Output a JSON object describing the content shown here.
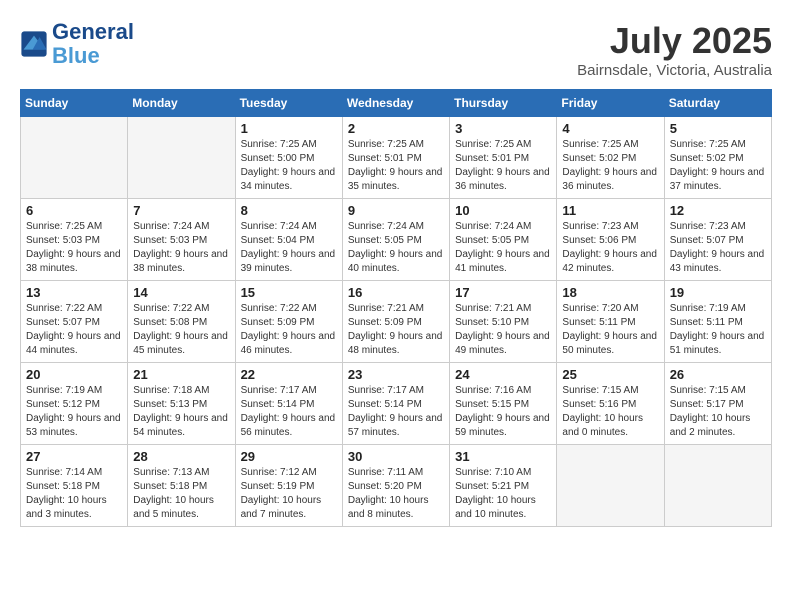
{
  "logo": {
    "line1": "General",
    "line2": "Blue"
  },
  "title": "July 2025",
  "location": "Bairnsdale, Victoria, Australia",
  "days_of_week": [
    "Sunday",
    "Monday",
    "Tuesday",
    "Wednesday",
    "Thursday",
    "Friday",
    "Saturday"
  ],
  "weeks": [
    [
      {
        "day": "",
        "empty": true
      },
      {
        "day": "",
        "empty": true
      },
      {
        "day": "1",
        "sunrise": "7:25 AM",
        "sunset": "5:00 PM",
        "daylight": "9 hours and 34 minutes."
      },
      {
        "day": "2",
        "sunrise": "7:25 AM",
        "sunset": "5:01 PM",
        "daylight": "9 hours and 35 minutes."
      },
      {
        "day": "3",
        "sunrise": "7:25 AM",
        "sunset": "5:01 PM",
        "daylight": "9 hours and 36 minutes."
      },
      {
        "day": "4",
        "sunrise": "7:25 AM",
        "sunset": "5:02 PM",
        "daylight": "9 hours and 36 minutes."
      },
      {
        "day": "5",
        "sunrise": "7:25 AM",
        "sunset": "5:02 PM",
        "daylight": "9 hours and 37 minutes."
      }
    ],
    [
      {
        "day": "6",
        "sunrise": "7:25 AM",
        "sunset": "5:03 PM",
        "daylight": "9 hours and 38 minutes."
      },
      {
        "day": "7",
        "sunrise": "7:24 AM",
        "sunset": "5:03 PM",
        "daylight": "9 hours and 38 minutes."
      },
      {
        "day": "8",
        "sunrise": "7:24 AM",
        "sunset": "5:04 PM",
        "daylight": "9 hours and 39 minutes."
      },
      {
        "day": "9",
        "sunrise": "7:24 AM",
        "sunset": "5:05 PM",
        "daylight": "9 hours and 40 minutes."
      },
      {
        "day": "10",
        "sunrise": "7:24 AM",
        "sunset": "5:05 PM",
        "daylight": "9 hours and 41 minutes."
      },
      {
        "day": "11",
        "sunrise": "7:23 AM",
        "sunset": "5:06 PM",
        "daylight": "9 hours and 42 minutes."
      },
      {
        "day": "12",
        "sunrise": "7:23 AM",
        "sunset": "5:07 PM",
        "daylight": "9 hours and 43 minutes."
      }
    ],
    [
      {
        "day": "13",
        "sunrise": "7:22 AM",
        "sunset": "5:07 PM",
        "daylight": "9 hours and 44 minutes."
      },
      {
        "day": "14",
        "sunrise": "7:22 AM",
        "sunset": "5:08 PM",
        "daylight": "9 hours and 45 minutes."
      },
      {
        "day": "15",
        "sunrise": "7:22 AM",
        "sunset": "5:09 PM",
        "daylight": "9 hours and 46 minutes."
      },
      {
        "day": "16",
        "sunrise": "7:21 AM",
        "sunset": "5:09 PM",
        "daylight": "9 hours and 48 minutes."
      },
      {
        "day": "17",
        "sunrise": "7:21 AM",
        "sunset": "5:10 PM",
        "daylight": "9 hours and 49 minutes."
      },
      {
        "day": "18",
        "sunrise": "7:20 AM",
        "sunset": "5:11 PM",
        "daylight": "9 hours and 50 minutes."
      },
      {
        "day": "19",
        "sunrise": "7:19 AM",
        "sunset": "5:11 PM",
        "daylight": "9 hours and 51 minutes."
      }
    ],
    [
      {
        "day": "20",
        "sunrise": "7:19 AM",
        "sunset": "5:12 PM",
        "daylight": "9 hours and 53 minutes."
      },
      {
        "day": "21",
        "sunrise": "7:18 AM",
        "sunset": "5:13 PM",
        "daylight": "9 hours and 54 minutes."
      },
      {
        "day": "22",
        "sunrise": "7:17 AM",
        "sunset": "5:14 PM",
        "daylight": "9 hours and 56 minutes."
      },
      {
        "day": "23",
        "sunrise": "7:17 AM",
        "sunset": "5:14 PM",
        "daylight": "9 hours and 57 minutes."
      },
      {
        "day": "24",
        "sunrise": "7:16 AM",
        "sunset": "5:15 PM",
        "daylight": "9 hours and 59 minutes."
      },
      {
        "day": "25",
        "sunrise": "7:15 AM",
        "sunset": "5:16 PM",
        "daylight": "10 hours and 0 minutes."
      },
      {
        "day": "26",
        "sunrise": "7:15 AM",
        "sunset": "5:17 PM",
        "daylight": "10 hours and 2 minutes."
      }
    ],
    [
      {
        "day": "27",
        "sunrise": "7:14 AM",
        "sunset": "5:18 PM",
        "daylight": "10 hours and 3 minutes."
      },
      {
        "day": "28",
        "sunrise": "7:13 AM",
        "sunset": "5:18 PM",
        "daylight": "10 hours and 5 minutes."
      },
      {
        "day": "29",
        "sunrise": "7:12 AM",
        "sunset": "5:19 PM",
        "daylight": "10 hours and 7 minutes."
      },
      {
        "day": "30",
        "sunrise": "7:11 AM",
        "sunset": "5:20 PM",
        "daylight": "10 hours and 8 minutes."
      },
      {
        "day": "31",
        "sunrise": "7:10 AM",
        "sunset": "5:21 PM",
        "daylight": "10 hours and 10 minutes."
      },
      {
        "day": "",
        "empty": true
      },
      {
        "day": "",
        "empty": true
      }
    ]
  ]
}
